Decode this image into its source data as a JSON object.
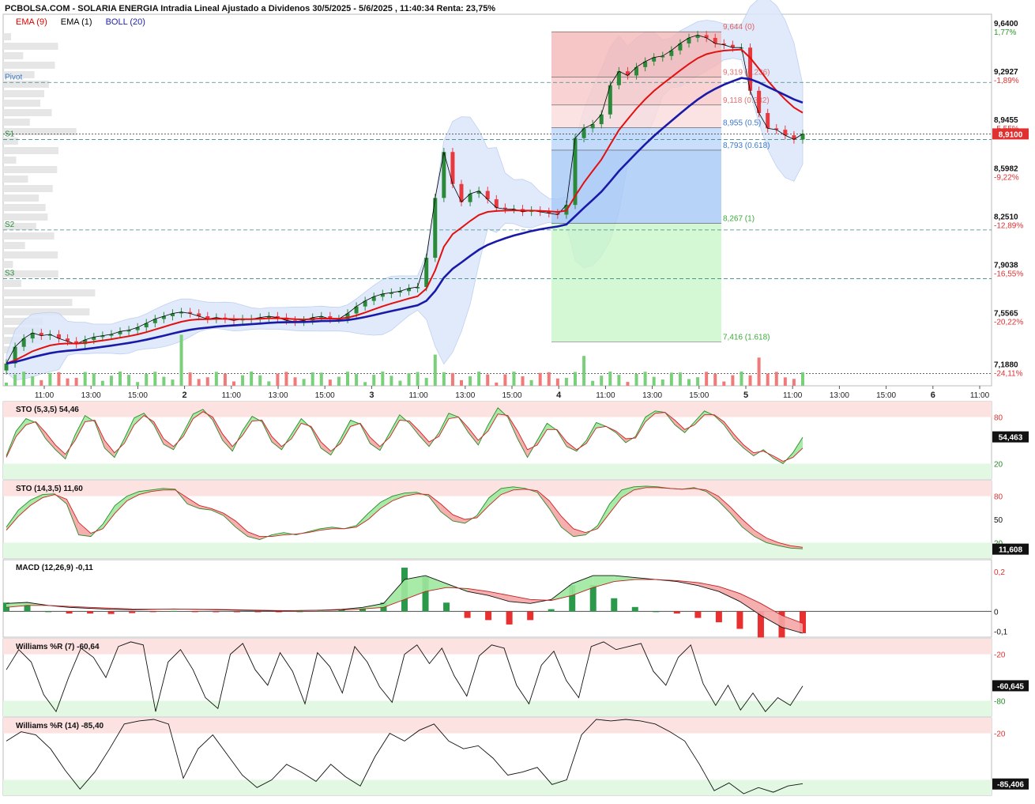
{
  "header": {
    "title": "PCBOLSA.COM - SOLARIA ENERGIA Intradia Lineal Ajustado a Dividenos 30/5/2025 - 5/6/2025 , 11:40:34 Renta: 23,75%"
  },
  "legend": [
    {
      "label": "EMA (9)",
      "color": "#e00000"
    },
    {
      "label": "EMA (1)",
      "color": "#000000"
    },
    {
      "label": "BOLL (20)",
      "color": "#2222aa"
    }
  ],
  "colors": {
    "up": "#2a8a3a",
    "down": "#e8393f",
    "ema9": "#e31010",
    "boll_mid": "#1a1aa8",
    "boll_fill": "#dbe7fb",
    "fib_red": "#f4b6b6",
    "fib_blue": "#aaccf8",
    "fib_green": "#c4f5c4",
    "pivot_line": "#3a8a8a",
    "price_tag": "#e03030"
  },
  "chart_data": [
    {
      "type": "candlestick",
      "title": "",
      "ylim": [
        7.1,
        9.77
      ],
      "x_ticks": [
        "11:00",
        "13:00",
        "15:00",
        "2",
        "11:00",
        "13:00",
        "15:00",
        "3",
        "11:00",
        "13:00",
        "15:00",
        "4",
        "11:00",
        "13:00",
        "15:00",
        "5",
        "11:00",
        "13:00",
        "15:00",
        "6",
        "11:00"
      ],
      "y_ticks": [
        {
          "value": 9.64,
          "label": "9,6400",
          "pct": "1,77%"
        },
        {
          "value": 9.2927,
          "label": "9,2927",
          "pct": "-1,89%"
        },
        {
          "value": 8.9455,
          "label": "8,9455",
          "pct": "-5,55%"
        },
        {
          "value": 8.5982,
          "label": "8,5982",
          "pct": "-9,22%"
        },
        {
          "value": 8.251,
          "label": "8,2510",
          "pct": "-12,89%"
        },
        {
          "value": 7.9038,
          "label": "7,9038",
          "pct": "-16,55%"
        },
        {
          "value": 7.5565,
          "label": "7,5565",
          "pct": "-20,22%"
        },
        {
          "value": 7.188,
          "label": "7,1880",
          "pct": "-24,11%"
        }
      ],
      "last_price": {
        "value": 8.91,
        "label": "8,9100"
      },
      "pivots": [
        {
          "name": "Pivot",
          "value": 9.28
        },
        {
          "name": "S1",
          "value": 8.87
        },
        {
          "name": "S2",
          "value": 8.22
        },
        {
          "name": "S3",
          "value": 7.87
        }
      ],
      "fibonacci": [
        {
          "label": "9,644 (0)",
          "value": 9.644
        },
        {
          "label": "9,319 (0.236)",
          "value": 9.319
        },
        {
          "label": "9,118 (0.382)",
          "value": 9.118
        },
        {
          "label": "8,955 (0.5)",
          "value": 8.955
        },
        {
          "label": "8,793 (0.618)",
          "value": 8.793
        },
        {
          "label": "8,267 (1)",
          "value": 8.267
        },
        {
          "label": "7,416 (1.618)",
          "value": 7.416
        }
      ],
      "close_series": [
        7.26,
        7.38,
        7.44,
        7.48,
        7.46,
        7.47,
        7.44,
        7.42,
        7.4,
        7.43,
        7.45,
        7.46,
        7.47,
        7.49,
        7.5,
        7.52,
        7.55,
        7.58,
        7.6,
        7.62,
        7.63,
        7.62,
        7.6,
        7.58,
        7.59,
        7.58,
        7.57,
        7.58,
        7.58,
        7.59,
        7.6,
        7.59,
        7.57,
        7.56,
        7.57,
        7.59,
        7.6,
        7.58,
        7.58,
        7.62,
        7.67,
        7.71,
        7.74,
        7.76,
        7.77,
        7.78,
        7.8,
        7.81,
        8.02,
        8.45,
        8.78,
        8.55,
        8.42,
        8.48,
        8.5,
        8.44,
        8.38,
        8.37,
        8.37,
        8.35,
        8.36,
        8.35,
        8.34,
        8.33,
        8.4,
        8.88,
        8.95,
        8.98,
        9.05,
        9.26,
        9.36,
        9.33,
        9.39,
        9.43,
        9.46,
        9.47,
        9.51,
        9.56,
        9.6,
        9.62,
        9.6,
        9.56,
        9.55,
        9.53,
        9.53,
        9.22,
        9.06,
        8.95,
        8.94,
        8.9,
        8.87,
        8.91
      ],
      "volume_note": "volume bars shown at bottom of main panel"
    },
    {
      "type": "line",
      "title": "STO (5,3,5)",
      "last_value": "54,46",
      "tag": "54,463",
      "ylim": [
        0,
        100
      ],
      "y_ticks": [
        {
          "value": 80,
          "label": "80"
        },
        {
          "value": 20,
          "label": "20"
        }
      ],
      "k": [
        30,
        62,
        78,
        73,
        52,
        38,
        26,
        57,
        82,
        74,
        40,
        28,
        52,
        79,
        85,
        70,
        45,
        38,
        60,
        84,
        90,
        76,
        50,
        36,
        62,
        81,
        74,
        48,
        38,
        58,
        78,
        66,
        40,
        31,
        52,
        76,
        71,
        46,
        37,
        60,
        83,
        72,
        56,
        42,
        60,
        85,
        80,
        60,
        44,
        70,
        92,
        80,
        52,
        28,
        50,
        72,
        63,
        42,
        36,
        50,
        73,
        68,
        60,
        47,
        55,
        80,
        88,
        86,
        70,
        60,
        74,
        88,
        82,
        70,
        52,
        40,
        30,
        38,
        27,
        20,
        34,
        54
      ],
      "d": [
        28,
        55,
        70,
        74,
        60,
        44,
        32,
        50,
        74,
        76,
        50,
        34,
        46,
        70,
        82,
        74,
        52,
        42,
        55,
        78,
        87,
        80,
        58,
        42,
        56,
        75,
        76,
        55,
        42,
        52,
        72,
        68,
        48,
        36,
        46,
        68,
        72,
        54,
        42,
        54,
        76,
        75,
        62,
        48,
        55,
        78,
        80,
        66,
        50,
        62,
        84,
        82,
        62,
        38,
        44,
        64,
        64,
        48,
        38,
        46,
        66,
        68,
        62,
        52,
        53,
        74,
        85,
        86,
        76,
        64,
        70,
        83,
        83,
        74,
        58,
        44,
        34,
        36,
        30,
        23,
        28,
        40
      ]
    },
    {
      "type": "line",
      "title": "STO (14,3,5)",
      "last_value": "11,60",
      "tag": "11,608",
      "ylim": [
        0,
        100
      ],
      "y_ticks": [
        {
          "value": 80,
          "label": "80"
        },
        {
          "value": 50,
          "label": "50"
        },
        {
          "value": 20,
          "label": "20"
        }
      ],
      "k": [
        40,
        62,
        75,
        82,
        83,
        70,
        30,
        28,
        44,
        68,
        80,
        86,
        88,
        90,
        89,
        70,
        64,
        62,
        55,
        40,
        28,
        24,
        30,
        33,
        30,
        34,
        38,
        40,
        38,
        42,
        58,
        72,
        80,
        84,
        85,
        80,
        60,
        48,
        45,
        55,
        78,
        90,
        92,
        90,
        85,
        64,
        40,
        28,
        30,
        42,
        70,
        88,
        92,
        93,
        92,
        90,
        89,
        91,
        86,
        74,
        58,
        40,
        28,
        20,
        16,
        13,
        12
      ],
      "d": [
        36,
        54,
        68,
        78,
        82,
        76,
        46,
        32,
        38,
        58,
        74,
        82,
        86,
        88,
        88,
        78,
        68,
        64,
        58,
        48,
        34,
        28,
        28,
        30,
        31,
        33,
        36,
        38,
        38,
        40,
        50,
        64,
        74,
        80,
        83,
        82,
        70,
        56,
        50,
        52,
        68,
        82,
        88,
        89,
        87,
        74,
        54,
        38,
        33,
        38,
        58,
        78,
        88,
        91,
        91,
        90,
        89,
        90,
        88,
        80,
        66,
        50,
        36,
        26,
        20,
        16,
        14
      ]
    },
    {
      "type": "line",
      "title": "MACD (12,26,9)",
      "last_value": "-0,11",
      "ylim": [
        -0.13,
        0.26
      ],
      "y_ticks": [
        {
          "value": 0.2,
          "label": "0,2"
        },
        {
          "value": 0,
          "label": "0"
        },
        {
          "value": -0.1,
          "label": "-0,1"
        }
      ],
      "macd": [
        0.04,
        0.045,
        0.03,
        0.02,
        0.015,
        0.01,
        0.008,
        0.01,
        0.012,
        0.01,
        0.008,
        0.006,
        0.004,
        0.002,
        0.004,
        0.006,
        0.01,
        0.02,
        0.04,
        0.16,
        0.18,
        0.14,
        0.1,
        0.08,
        0.05,
        0.04,
        0.06,
        0.14,
        0.18,
        0.18,
        0.17,
        0.16,
        0.15,
        0.13,
        0.1,
        0.05,
        -0.02,
        -0.08,
        -0.11
      ],
      "signal": [
        0.02,
        0.03,
        0.03,
        0.025,
        0.02,
        0.016,
        0.012,
        0.011,
        0.011,
        0.011,
        0.01,
        0.008,
        0.006,
        0.004,
        0.004,
        0.005,
        0.007,
        0.012,
        0.02,
        0.06,
        0.1,
        0.12,
        0.115,
        0.1,
        0.08,
        0.06,
        0.055,
        0.08,
        0.12,
        0.15,
        0.16,
        0.16,
        0.155,
        0.145,
        0.125,
        0.09,
        0.04,
        -0.02,
        -0.06
      ]
    },
    {
      "type": "line",
      "title": "Williams %R (7)",
      "last_value": "-60,64",
      "tag": "-60,645",
      "ylim": [
        -100,
        0
      ],
      "y_ticks": [
        {
          "value": -20,
          "label": "-20"
        },
        {
          "value": -80,
          "label": "-80"
        }
      ],
      "values": [
        -40,
        -14,
        -30,
        -72,
        -94,
        -50,
        -12,
        -24,
        -50,
        -10,
        -4,
        -8,
        -94,
        -30,
        -14,
        -40,
        -76,
        -90,
        -20,
        -6,
        -40,
        -60,
        -18,
        -42,
        -84,
        -18,
        -36,
        -70,
        -10,
        -30,
        -62,
        -82,
        -20,
        -8,
        -32,
        -12,
        -48,
        -74,
        -22,
        -8,
        -12,
        -60,
        -84,
        -34,
        -16,
        -54,
        -76,
        -10,
        -4,
        -14,
        -10,
        -6,
        -42,
        -60,
        -24,
        -8,
        -58,
        -86,
        -60,
        -92,
        -70,
        -94,
        -76,
        -86,
        -61
      ]
    },
    {
      "type": "line",
      "title": "Williams %R (14)",
      "last_value": "-85,40",
      "tag": "-85,406",
      "ylim": [
        -100,
        0
      ],
      "y_ticks": [
        {
          "value": -20,
          "label": "-20"
        }
      ],
      "values": [
        -30,
        -18,
        -22,
        -40,
        -68,
        -92,
        -70,
        -40,
        -8,
        -4,
        -2,
        -8,
        -78,
        -40,
        -22,
        -48,
        -74,
        -90,
        -80,
        -60,
        -70,
        -82,
        -60,
        -76,
        -88,
        -50,
        -20,
        -30,
        -16,
        -8,
        -30,
        -40,
        -36,
        -52,
        -74,
        -70,
        -64,
        -86,
        -80,
        -22,
        -2,
        -4,
        -2,
        -4,
        -8,
        -18,
        -30,
        -60,
        -94,
        -84,
        -98,
        -90,
        -96,
        -88,
        -85
      ]
    }
  ]
}
